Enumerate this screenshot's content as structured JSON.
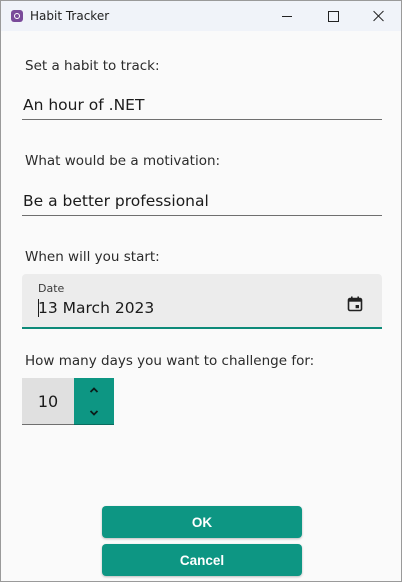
{
  "window": {
    "title": "Habit Tracker"
  },
  "form": {
    "habit": {
      "label": "Set a habit to track:",
      "value": "An hour of .NET"
    },
    "motivation": {
      "label": "What would be a motivation:",
      "value": "Be a better professional"
    },
    "start": {
      "label": "When will you start:",
      "field_caption": "Date",
      "value": "13 March 2023",
      "icon": "calendar-icon"
    },
    "days": {
      "label": "How many days you want to challenge for:",
      "value": "10"
    }
  },
  "actions": {
    "ok_label": "OK",
    "cancel_label": "Cancel"
  },
  "colors": {
    "accent": "#0d9683",
    "field_background": "#ececec"
  }
}
